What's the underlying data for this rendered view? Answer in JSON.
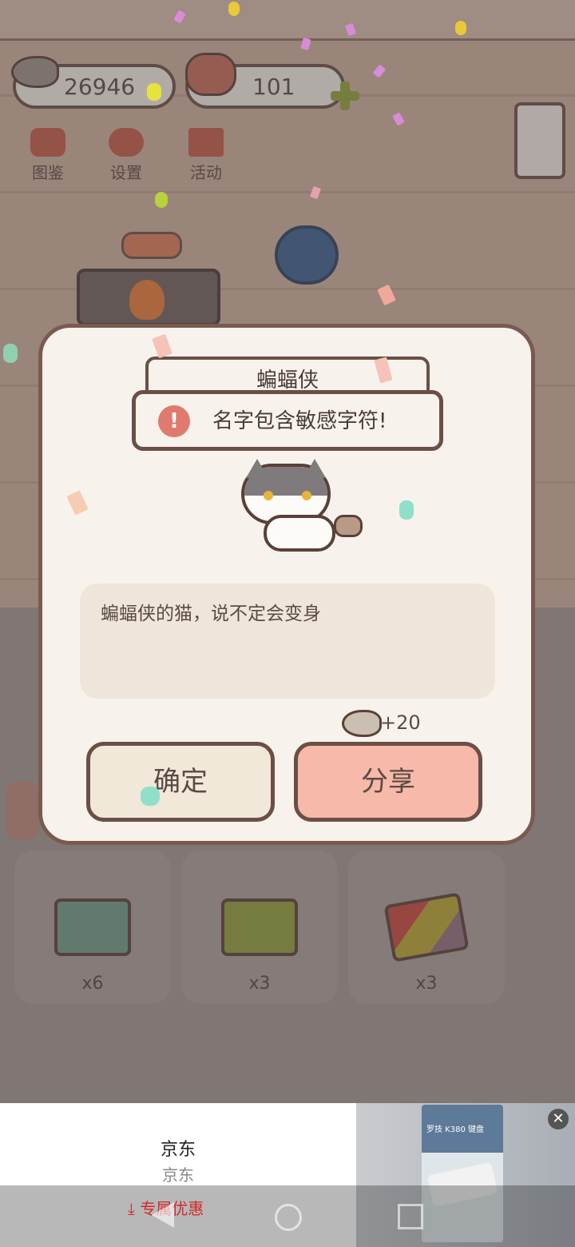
{
  "hud": {
    "fish_count": "26946",
    "heart_count": "101"
  },
  "menu": [
    {
      "label": "图鉴",
      "icon": "cat-face-icon"
    },
    {
      "label": "设置",
      "icon": "gear-icon"
    },
    {
      "label": "活动",
      "icon": "gift-icon"
    }
  ],
  "dialog": {
    "cat_name": "蝙蝠侠",
    "toast_message": "名字包含敏感字符!",
    "description": "蝙蝠侠的猫，说不定会变身",
    "reward": "+20",
    "confirm_label": "确定",
    "share_label": "分享"
  },
  "cards": [
    {
      "count": "x6",
      "icon": "basketball-ticket-icon",
      "color": "#6e9a87"
    },
    {
      "count": "x3",
      "icon": "panda-ticket-icon",
      "color": "#8f9b3a"
    },
    {
      "count": "x3",
      "icon": "mystery-ticket-icon",
      "color": "#c4463d"
    }
  ],
  "ad": {
    "title": "京东",
    "subtitle": "京东",
    "promo": "专属优惠",
    "product_text": "罗技 K380 键盘"
  },
  "colors": {
    "accent": "#6b4f46",
    "share_button": "#f6b9aa",
    "confirm_button": "#f1e8da",
    "error": "#e07a6e"
  }
}
